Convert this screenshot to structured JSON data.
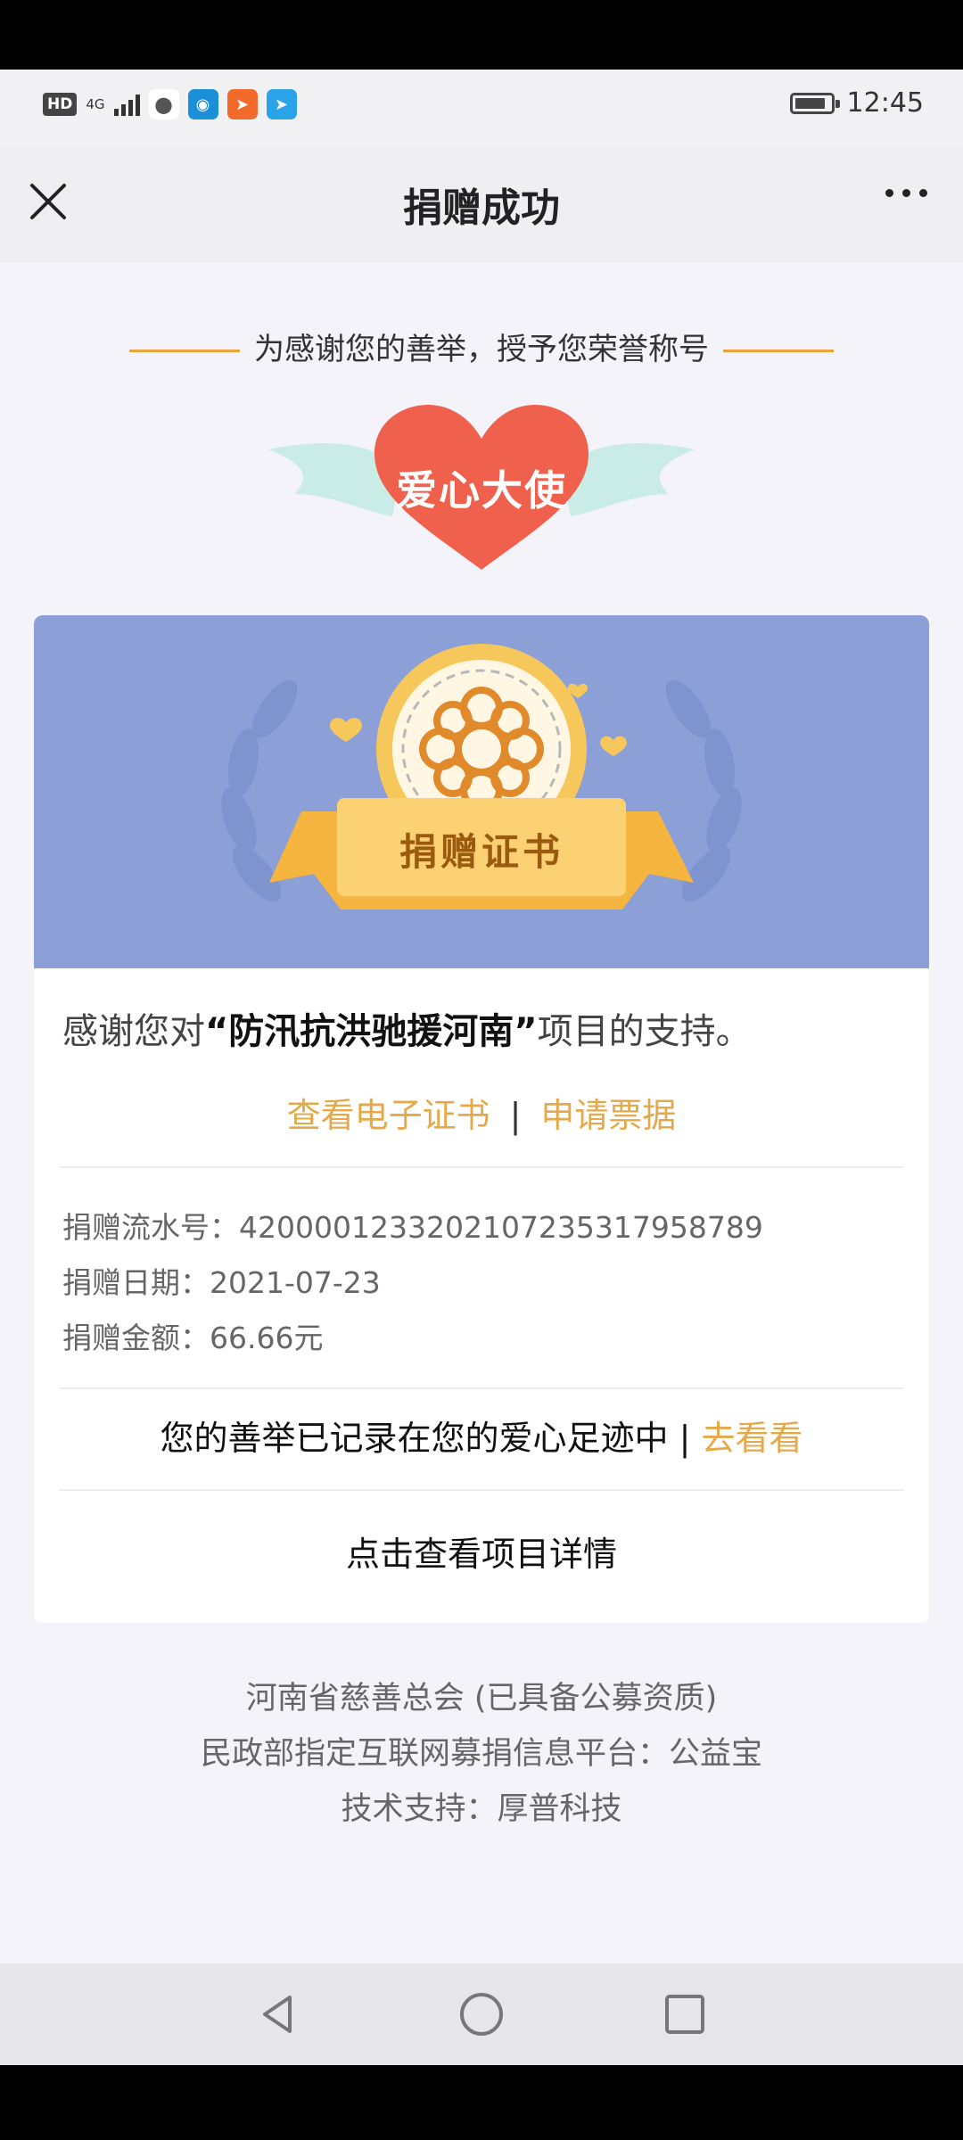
{
  "status_bar": {
    "hd": "HD",
    "network": "4G",
    "time": "12:45"
  },
  "navbar": {
    "title": "捐赠成功"
  },
  "honor": {
    "intro": "为感谢您的善举，授予您荣誉称号",
    "title": "爱心大使"
  },
  "certificate": {
    "label": "捐赠证书",
    "thanks_prefix": "感谢您对",
    "project": "“防汛抗洪驰援河南”",
    "thanks_suffix": "项目的支持。",
    "view_cert": "查看电子证书",
    "separator": "|",
    "apply_receipt": "申请票据",
    "serial": "捐赠流水号：4200001233202107235317958789",
    "date": "捐赠日期：2021-07-23",
    "amount": "捐赠金额：66.66元",
    "footprint_text": "您的善举已记录在您的爱心足迹中 | ",
    "footprint_link": "去看看",
    "project_detail": "点击查看项目详情"
  },
  "footer": {
    "line1": "河南省慈善总会 (已具备公募资质)",
    "line2": "民政部指定互联网募捐信息平台：公益宝",
    "line3": "技术支持：厚普科技"
  },
  "colors": {
    "accent": "#e4a94a",
    "banner": "#8c9fd7",
    "heart": "#f0614d"
  }
}
